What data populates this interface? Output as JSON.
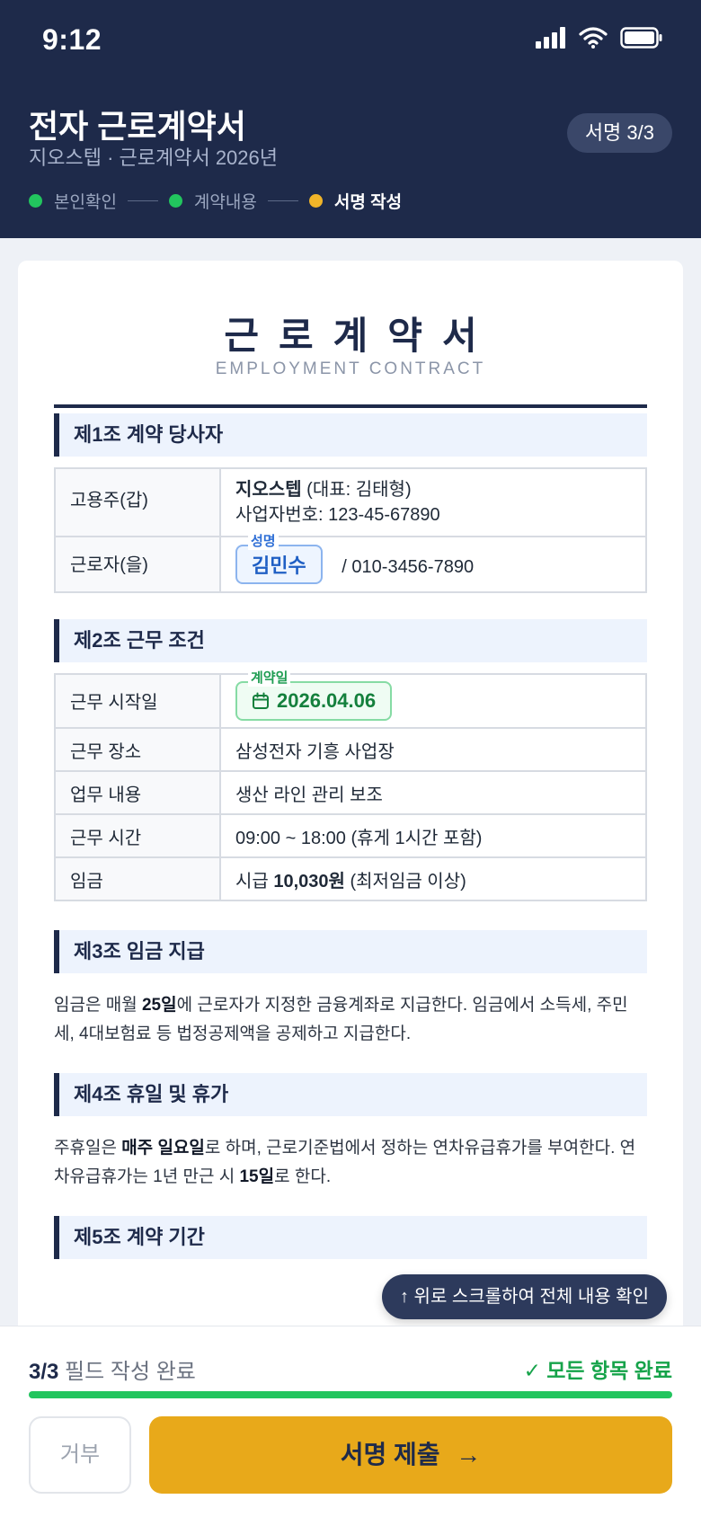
{
  "status_bar": {
    "time": "9:12"
  },
  "header": {
    "title": "전자 근로계약서",
    "subtitle": "지오스텝 · 근로계약서 2026년",
    "sign_badge": "서명 3/3",
    "steps": [
      {
        "label": "본인확인",
        "state": "done"
      },
      {
        "label": "계약내용",
        "state": "done"
      },
      {
        "label": "서명 작성",
        "state": "active"
      }
    ]
  },
  "document": {
    "title": "근로계약서",
    "subtitle": "EMPLOYMENT CONTRACT",
    "section1": {
      "heading": "제1조  계약 당사자",
      "employer_label": "고용주(갑)",
      "employer_name": "지오스텝",
      "employer_rep": " (대표: 김태형)",
      "employer_bizno": "사업자번호: 123-45-67890",
      "employee_label": "근로자(을)",
      "name_field_label": "성명",
      "name_value": "김민수",
      "employee_phone": "/ 010-3456-7890"
    },
    "section2": {
      "heading": "제2조  근무 조건",
      "start_label": "근무 시작일",
      "date_field_label": "계약일",
      "date_value": "2026.04.06",
      "rows": [
        {
          "k": "근무 장소",
          "v": "삼성전자 기흥 사업장"
        },
        {
          "k": "업무 내용",
          "v": "생산 라인 관리 보조"
        },
        {
          "k": "근무 시간",
          "v": "09:00 ~ 18:00 (휴게 1시간 포함)"
        }
      ],
      "wage_label": "임금",
      "wage_prefix": "시급 ",
      "wage_amount": "10,030원",
      "wage_suffix": " (최저임금 이상)"
    },
    "section3": {
      "heading": "제3조  임금 지급",
      "p1": "임금은 매월 ",
      "p1_bold": "25일",
      "p1_rest": "에 근로자가 지정한 금융계좌로 지급한다. 임금에서 소득세, 주민세, 4대보험료 등 법정공제액을 공제하고 지급한다."
    },
    "section4": {
      "heading": "제4조  휴일 및 휴가",
      "p1": "주휴일은 ",
      "p1_bold": "매주 일요일",
      "p1_mid": "로 하며, 근로기준법에서 정하는 연차유급휴가를 부여한다. 연차유급휴가는 1년 만근 시 ",
      "p1_bold2": "15일",
      "p1_rest": "로 한다."
    },
    "section5": {
      "heading": "제5조  계약 기간"
    }
  },
  "scroll_hint": "↑ 위로 스크롤하여 전체 내용 확인",
  "footer": {
    "progress_count": "3/3",
    "progress_text": " 필드 작성 완료",
    "progress_fraction": 1.0,
    "complete_label": "✓ 모든 항목 완료",
    "reject_label": "거부",
    "submit_label": "서명 제출",
    "submit_arrow": "→"
  },
  "colors": {
    "header_bg": "#1e2a4a",
    "accent": "#e8a91a",
    "success": "#22c55e"
  }
}
